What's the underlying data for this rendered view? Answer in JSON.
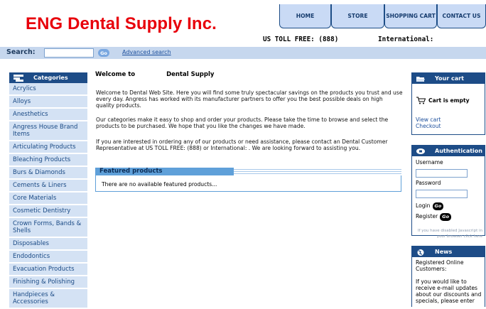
{
  "header": {
    "logo_text": "ENG Dental Supply Inc.",
    "nav": [
      {
        "label": "HOME"
      },
      {
        "label": "STORE"
      },
      {
        "label": "SHOPPING CART"
      },
      {
        "label": "CONTACT US"
      }
    ],
    "toll_free": "US TOLL FREE: (888)",
    "international": "International:"
  },
  "search": {
    "label": "Search:",
    "value": "",
    "go_label": "Go",
    "advanced_label": "Advanced search"
  },
  "categories": {
    "title": "Categories",
    "items": [
      "Acrylics",
      "Alloys",
      "Anesthetics",
      "Angress House Brand Items",
      "Articulating Products",
      "Bleaching Products",
      "Burs & Diamonds",
      "Cements & Liners",
      "Core Materials",
      "Cosmetic Dentistry",
      "Crown Forms, Bands & Shells",
      "Disposables",
      "Endodontics",
      "Evacuation Products",
      "Finishing & Polishing",
      "Handpieces & Accessories"
    ]
  },
  "main": {
    "welcome_title_part1": "Welcome to",
    "welcome_title_part2": "Dental Supply",
    "para1": "Welcome to          Dental Web Site.  Here you will find some truly spectacular savings on the products you trust and use every day. Angress has worked with its manufacturer partners to offer you the best possible deals on high quality products.",
    "para2": "Our categories make it easy to shop and order your products. Please take the time to browse and select the products to be purchased. We hope that you like the changes we have made.",
    "para3": "If you are interested in ordering any of our products or need assistance, please contact an            Dental Customer Representative at US TOLL FREE: (888)            or International:            .  We are looking forward to assisting you.",
    "featured_title": "Featured products",
    "featured_message": "There are no available featured products..."
  },
  "cart": {
    "title": "Your cart",
    "status": "Cart is empty",
    "view_cart": "View cart",
    "checkout": "Checkout"
  },
  "auth": {
    "title": "Authentication",
    "username_label": "Username",
    "password_label": "Password",
    "login_label": "Login",
    "register_label": "Register",
    "go_label": "Go",
    "js_note": "If you have disabled Javascript in your browser click here"
  },
  "news": {
    "title": "News",
    "text1": "Registered Online Customers:",
    "text2": "If you would like to receive e-mail updates about our discounts and specials, please enter"
  },
  "colors": {
    "brand_red": "#e8000b",
    "nav_blue": "#1d4c87",
    "light_blue": "#d4e2f4"
  }
}
